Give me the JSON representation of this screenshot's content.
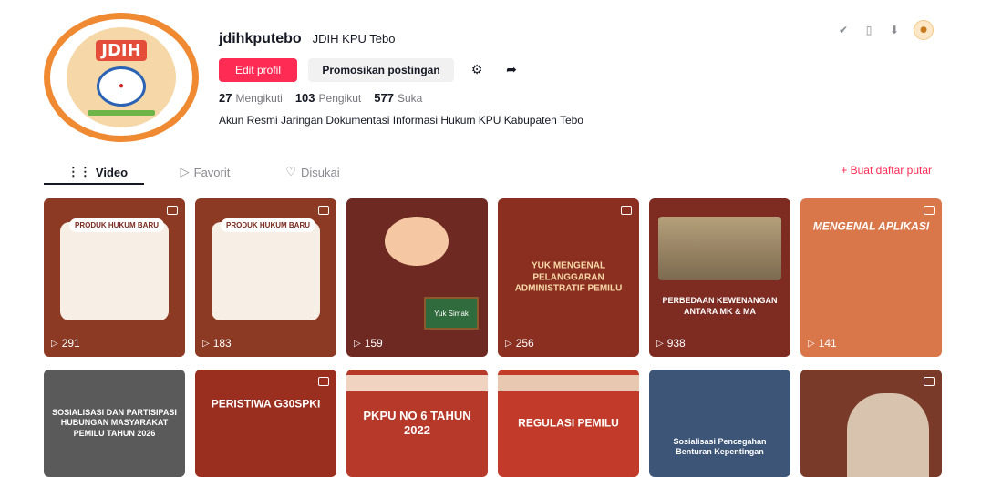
{
  "header": {
    "username": "jdihkputebo",
    "nickname": "JDIH KPU Tebo",
    "buttons": {
      "edit": "Edit profil",
      "promote": "Promosikan postingan"
    },
    "stats": [
      {
        "value": "27",
        "label": "Mengikuti"
      },
      {
        "value": "103",
        "label": "Pengikut"
      },
      {
        "value": "577",
        "label": "Suka"
      }
    ],
    "bio": "Akun Resmi Jaringan Dokumentasi Informasi Hukum KPU Kabupaten Tebo",
    "avatar_text": "JDIH"
  },
  "tabs": [
    {
      "label": "Video",
      "icon": "grid-icon"
    },
    {
      "label": "Favorit",
      "icon": "bookmark-icon"
    },
    {
      "label": "Disukai",
      "icon": "heart-icon"
    }
  ],
  "playlist_label": "+ Buat daftar putar",
  "videos": [
    {
      "views": "291",
      "caption": "PRODUK HUKUM BARU",
      "color": "#8d3a25"
    },
    {
      "views": "183",
      "caption": "PRODUK HUKUM BARU",
      "color": "#8d3a25"
    },
    {
      "views": "159",
      "caption": "Yuk Simak",
      "color": "#6e2a22"
    },
    {
      "views": "256",
      "caption": "YUK MENGENAL PELANGGARAN ADMINISTRATIF PEMILU",
      "color": "#8b3020"
    },
    {
      "views": "938",
      "caption": "PERBEDAAN KEWENANGAN ANTARA MK & MA",
      "color": "#7e2b22"
    },
    {
      "views": "141",
      "caption": "MENGENAL APLIKASI",
      "color": "#d9774a"
    },
    {
      "views": "",
      "caption": "SOSIALISASI DAN PARTISIPASI HUBUNGAN MASYARAKAT PEMILU TAHUN 2026",
      "color": "#5a5a5a"
    },
    {
      "views": "",
      "caption": "PERISTIWA G30SPKI",
      "color": "#9a2e1f"
    },
    {
      "views": "",
      "caption": "PKPU NO 6 TAHUN 2022",
      "color": "#b6392a"
    },
    {
      "views": "",
      "caption": "REGULASI PEMILU",
      "color": "#c23b2a"
    },
    {
      "views": "",
      "caption": "Sosialisasi Pencegahan Benturan Kepentingan",
      "color": "#3d5678"
    },
    {
      "views": "",
      "caption": "",
      "color": "#7a3a2a"
    }
  ]
}
